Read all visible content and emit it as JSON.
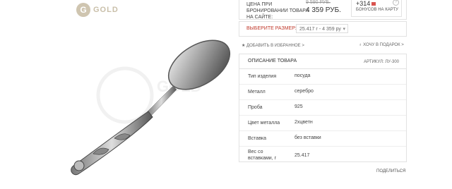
{
  "brand": {
    "logo_letter": "G",
    "logo_text": "GOLD"
  },
  "price": {
    "label": "ЦЕНА ПРИ БРОНИРОВАНИИ ТОВАРА НА САЙТЕ:",
    "old_price": "9 590 РУБ.",
    "new_price": "4 359 РУБ.",
    "bonus_value": "+314",
    "bonus_label": "БОНУСОВ НА КАРТУ",
    "help": "?"
  },
  "size": {
    "label": "ВЫБЕРИТЕ РАЗМЕР:",
    "selected": "25.417 г - 4 359 ру"
  },
  "actions": {
    "favorite": "★ ДОБАВИТЬ В ИЗБРАННОЕ >",
    "gift": "♁ ХОЧУ В ПОДАРОК >",
    "share": "ПОДЕЛИТЬСЯ"
  },
  "description": {
    "title": "ОПИСАНИЕ ТОВАРА",
    "article": "АРТИКУЛ: ЛУ-300",
    "rows": [
      {
        "key": "Тип изделия",
        "value": "посуда"
      },
      {
        "key": "Металл",
        "value": "серебро"
      },
      {
        "key": "Проба",
        "value": "925"
      },
      {
        "key": "Цвет металла",
        "value": "2хцветн"
      },
      {
        "key": "Вставка",
        "value": "без вставки"
      },
      {
        "key": "Вес со вставками, г",
        "value": "25.417"
      }
    ]
  }
}
